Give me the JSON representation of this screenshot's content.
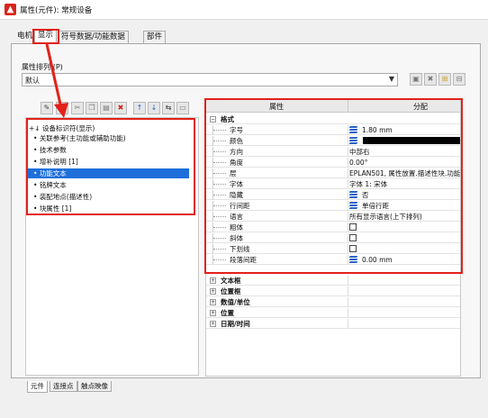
{
  "window": {
    "title": "属性(元件): 常规设备"
  },
  "tabs": [
    {
      "label": "电机"
    },
    {
      "label": "显示"
    },
    {
      "label": "符号数据/功能数据"
    },
    {
      "label": "部件"
    }
  ],
  "property_order": {
    "label": "属性排列:(P)",
    "value": "默认"
  },
  "left_toolbar": [
    "edit-icon",
    "new-icon",
    "cut-icon",
    "copy-icon",
    "paste-icon",
    "delete-icon",
    "move-up-icon",
    "move-down-icon",
    "split-icon",
    "frame-icon"
  ],
  "right_toolbar": [
    "save-icon",
    "delete-icon",
    "import-icon",
    "export-icon"
  ],
  "tree": [
    "设备标识符(显示)",
    "关联参考(主功能或辅助功能)",
    "技术参数",
    "增补说明 [1]",
    "功能文本",
    "铭牌文本",
    "装配地点(描述性)",
    "块属性 [1]"
  ],
  "grid": {
    "col_property": "属性",
    "col_assign": "分配",
    "group_format": "格式",
    "rows": [
      {
        "name": "字号",
        "value": "1.80 mm"
      },
      {
        "name": "颜色",
        "value": ""
      },
      {
        "name": "方向",
        "value": "中部右"
      },
      {
        "name": "角度",
        "value": "0.00°"
      },
      {
        "name": "层",
        "value": "EPLAN501, 属性放置.描述性块.功能文本"
      },
      {
        "name": "字体",
        "value": "字体 1: 宋体"
      },
      {
        "name": "隐藏",
        "value": "否"
      },
      {
        "name": "行间距",
        "value": "单倍行距"
      },
      {
        "name": "语言",
        "value": "所有显示语言(上下排列)"
      },
      {
        "name": "粗体",
        "value": ""
      },
      {
        "name": "斜体",
        "value": ""
      },
      {
        "name": "下划线",
        "value": ""
      },
      {
        "name": "段落间距",
        "value": "0.00 mm"
      }
    ],
    "groups": [
      "文本框",
      "位置框",
      "数值/单位",
      "位置",
      "日期/时间"
    ]
  },
  "bottom_tabs": [
    "元件",
    "连接点",
    "触点映像"
  ],
  "colors": {
    "accent": "#1e6fd9",
    "highlight": "#e3211a"
  }
}
